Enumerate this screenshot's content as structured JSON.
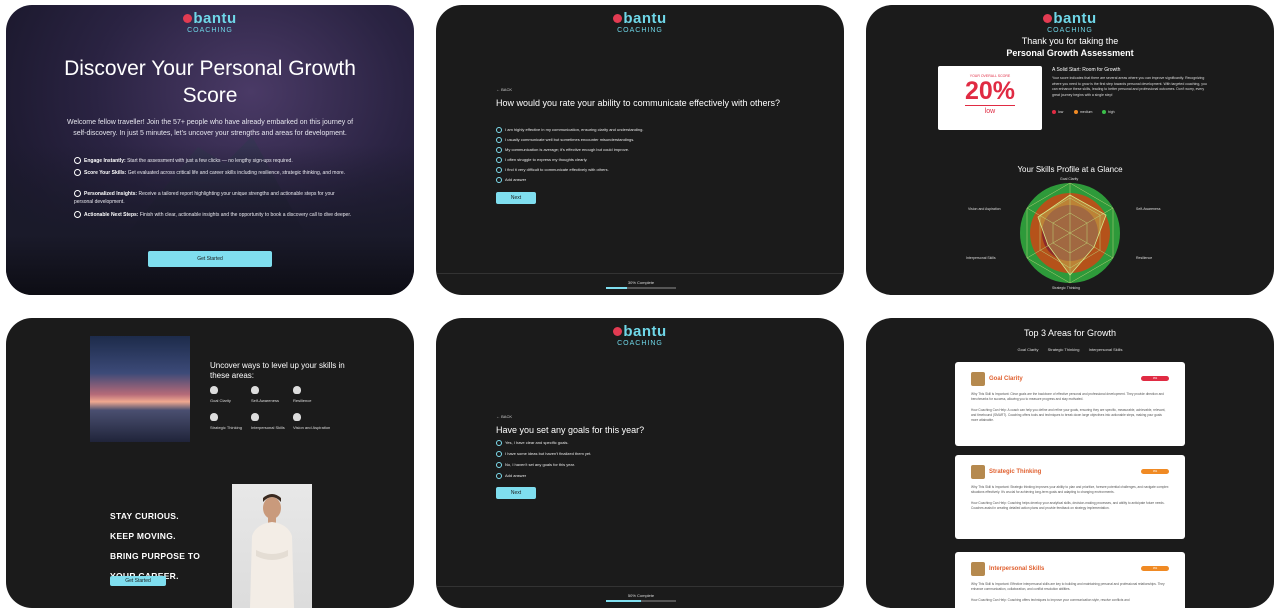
{
  "brand": {
    "name": "bantu",
    "sub": "COACHING"
  },
  "card1": {
    "title": "Discover Your Personal Growth Score",
    "intro": "Welcome fellow traveller! Join the 57+ people who have already embarked on this journey of self-discovery. In just 5 minutes, let's uncover your strengths and areas for development.",
    "bullets": [
      {
        "bold": "Engage Instantly:",
        "text": " Start the assessment with just a few clicks — no lengthy sign-ups required."
      },
      {
        "bold": "Score Your Skills:",
        "text": " Get evaluated across critical life and career skills including resilience, strategic thinking, and more."
      },
      {
        "bold": "Personalized Insights:",
        "text": " Receive a tailored report highlighting your unique strengths and actionable steps for your personal development."
      },
      {
        "bold": "Actionable Next Steps:",
        "text": " Finish with clear, actionable insights and the opportunity to book a discovery call to dive deeper."
      }
    ],
    "button": "Get Started"
  },
  "card2": {
    "back": "← BACK",
    "question": "How would you rate your ability to communicate effectively with others?",
    "options": [
      "I am highly effective in my communication, ensuring clarity and understanding.",
      "I usually communicate well but sometimes encounter misunderstandings.",
      "My communication is average; it's effective enough but could improve.",
      "I often struggle to express my thoughts clearly.",
      "I find it very difficult to communicate effectively with others.",
      "Add answer"
    ],
    "next": "Next",
    "progress": "30% Complete",
    "progress_value": 0.3
  },
  "card3": {
    "thanks_line1": "Thank you for taking the",
    "thanks_line2": "Personal Growth Assessment",
    "score_label": "YOUR OVERALL SCORE",
    "score": "20%",
    "score_level": "low",
    "heading": "A Solid Start: Room for Growth",
    "desc": "Your score indicates that there are several areas where you can improve significantly. Recognizing where you need to grow is the first step towards personal development. With targeted coaching, you can enhance these skills, leading to better personal and professional outcomes. Don't worry, every great journey begins with a single step!",
    "legend": [
      {
        "label": "low",
        "color": "#e02b43"
      },
      {
        "label": "medium",
        "color": "#f08a24"
      },
      {
        "label": "high",
        "color": "#3bbf4a"
      }
    ],
    "skills_title": "Your Skills Profile at a Glance",
    "radar_labels": [
      "Goal Clarity",
      "Self-Awareness",
      "Resilience",
      "Strategic Thinking",
      "Interpersonal Skills",
      "Vision and Aspiration"
    ]
  },
  "card4": {
    "uncover": "Uncover ways to level up your skills in these areas:",
    "skills": [
      "Goal Clarity",
      "Self-Awareness",
      "Resilience",
      "Strategic Thinking",
      "Interpersonal Skills",
      "Vision and Aspiration"
    ],
    "stay": [
      "STAY CURIOUS.",
      "KEEP MOVING.",
      "BRING PURPOSE TO",
      "YOUR CAREER."
    ],
    "button": "Get Started"
  },
  "card5": {
    "back": "← BACK",
    "question": "Have you set any goals for this year?",
    "options": [
      "Yes, I have clear and specific goals.",
      "I have some ideas but haven't finalized them yet.",
      "No, I haven't set any goals for this year.",
      "Add answer"
    ],
    "next": "Next",
    "progress": "50% Complete",
    "progress_value": 0.5
  },
  "card6": {
    "title": "Top 3 Areas for Growth",
    "tabs": [
      "Goal Clarity",
      "Strategic Thinking",
      "Interpersonal Skills"
    ],
    "areas": [
      {
        "name": "Goal Clarity",
        "pill": "0%",
        "pill_color": "#e02b43",
        "why": "Why This Skill is Important: Clear goals are the backbone of effective personal and professional development. They provide direction and benchmarks for success, allowing you to measure progress and stay motivated.",
        "how": "How Coaching Can Help: A coach can help you define and refine your goals, ensuring they are specific, measurable, achievable, relevant, and timebound (SMART). Coaching offers tools and techniques to break down large objectives into actionable steps, making your goals more attainable."
      },
      {
        "name": "Strategic Thinking",
        "pill": "0%",
        "pill_color": "#f08a24",
        "why": "Why This Skill is Important: Strategic thinking improves your ability to plan and prioritize, foresee potential challenges, and navigate complex situations effectively. It's crucial for achieving long-term goals and adapting to changing environments.",
        "how": "How Coaching Can Help: Coaching helps develop your analytical skills, decision-making processes, and ability to anticipate future needs. Coaches assist in creating detailed action plans and provide feedback on strategy implementation."
      },
      {
        "name": "Interpersonal Skills",
        "pill": "0%",
        "pill_color": "#f08a24",
        "why": "Why This Skill is Important: Effective interpersonal skills are key to building and maintaining personal and professional relationships. They enhance communication, collaboration, and conflict resolution abilities.",
        "how": "How Coaching Can Help: Coaching offers techniques to improve your communication style, resolve conflicts and"
      }
    ]
  }
}
